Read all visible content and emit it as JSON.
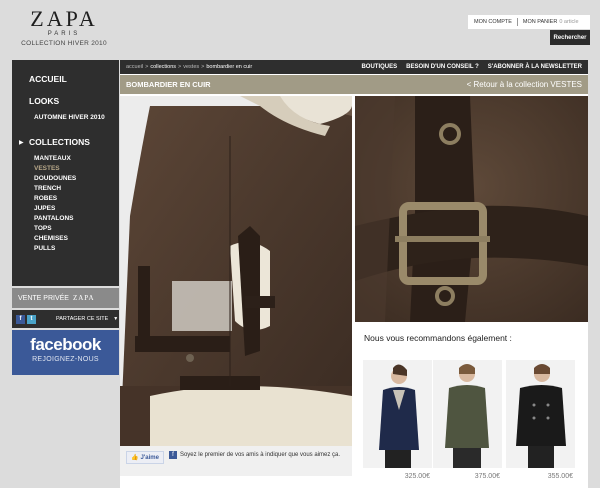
{
  "brand": {
    "name": "ZAPA",
    "city": "PARIS",
    "collection": "COLLECTION HIVER 2010"
  },
  "header": {
    "account": "MON COMPTE",
    "cart": "MON PANIER",
    "cart_count": "0 article",
    "search_button": "Rechercher"
  },
  "sidebar": {
    "main_items": [
      "ACCUEIL",
      "LOOKS",
      "COLLECTIONS"
    ],
    "looks_sub": "AUTOMNE HIVER 2010",
    "collection_items": [
      "MANTEAUX",
      "VESTES",
      "DOUDOUNES",
      "TRENCH",
      "ROBES",
      "JUPES",
      "PANTALONS",
      "TOPS",
      "CHEMISES",
      "PULLS"
    ],
    "active_item": "VESTES",
    "vente_privee": "VENTE PRIVÉE",
    "vente_brand": "ZAPA",
    "share": "PARTAGER CE SITE",
    "facebook_title": "facebook",
    "facebook_sub": "REJOIGNEZ-NOUS"
  },
  "breadcrumb": {
    "items": [
      "accueil",
      "collections",
      "vestes"
    ],
    "current": "bombardier en cuir",
    "separator": ">"
  },
  "topnav": [
    "BOUTIQUES",
    "BESOIN D'UN CONSEIL ?",
    "S'ABONNER À LA NEWSLETTER"
  ],
  "product": {
    "title": "BOMBARDIER EN CUIR",
    "back_link": "< Retour à la collection VESTES"
  },
  "facebook_like": {
    "button": "J'aime",
    "text": "Soyez le premier de vos amis à indiquer que vous aimez ça."
  },
  "recommendations": {
    "title": "Nous vous recommandons également :",
    "items": [
      {
        "price": "325.00€"
      },
      {
        "price": "375.00€"
      },
      {
        "price": "355.00€"
      }
    ]
  },
  "colors": {
    "sidebar_bg": "#2e2e2e",
    "title_bar": "#a19b86",
    "facebook": "#3b5998",
    "active_link": "#b8a88a"
  }
}
